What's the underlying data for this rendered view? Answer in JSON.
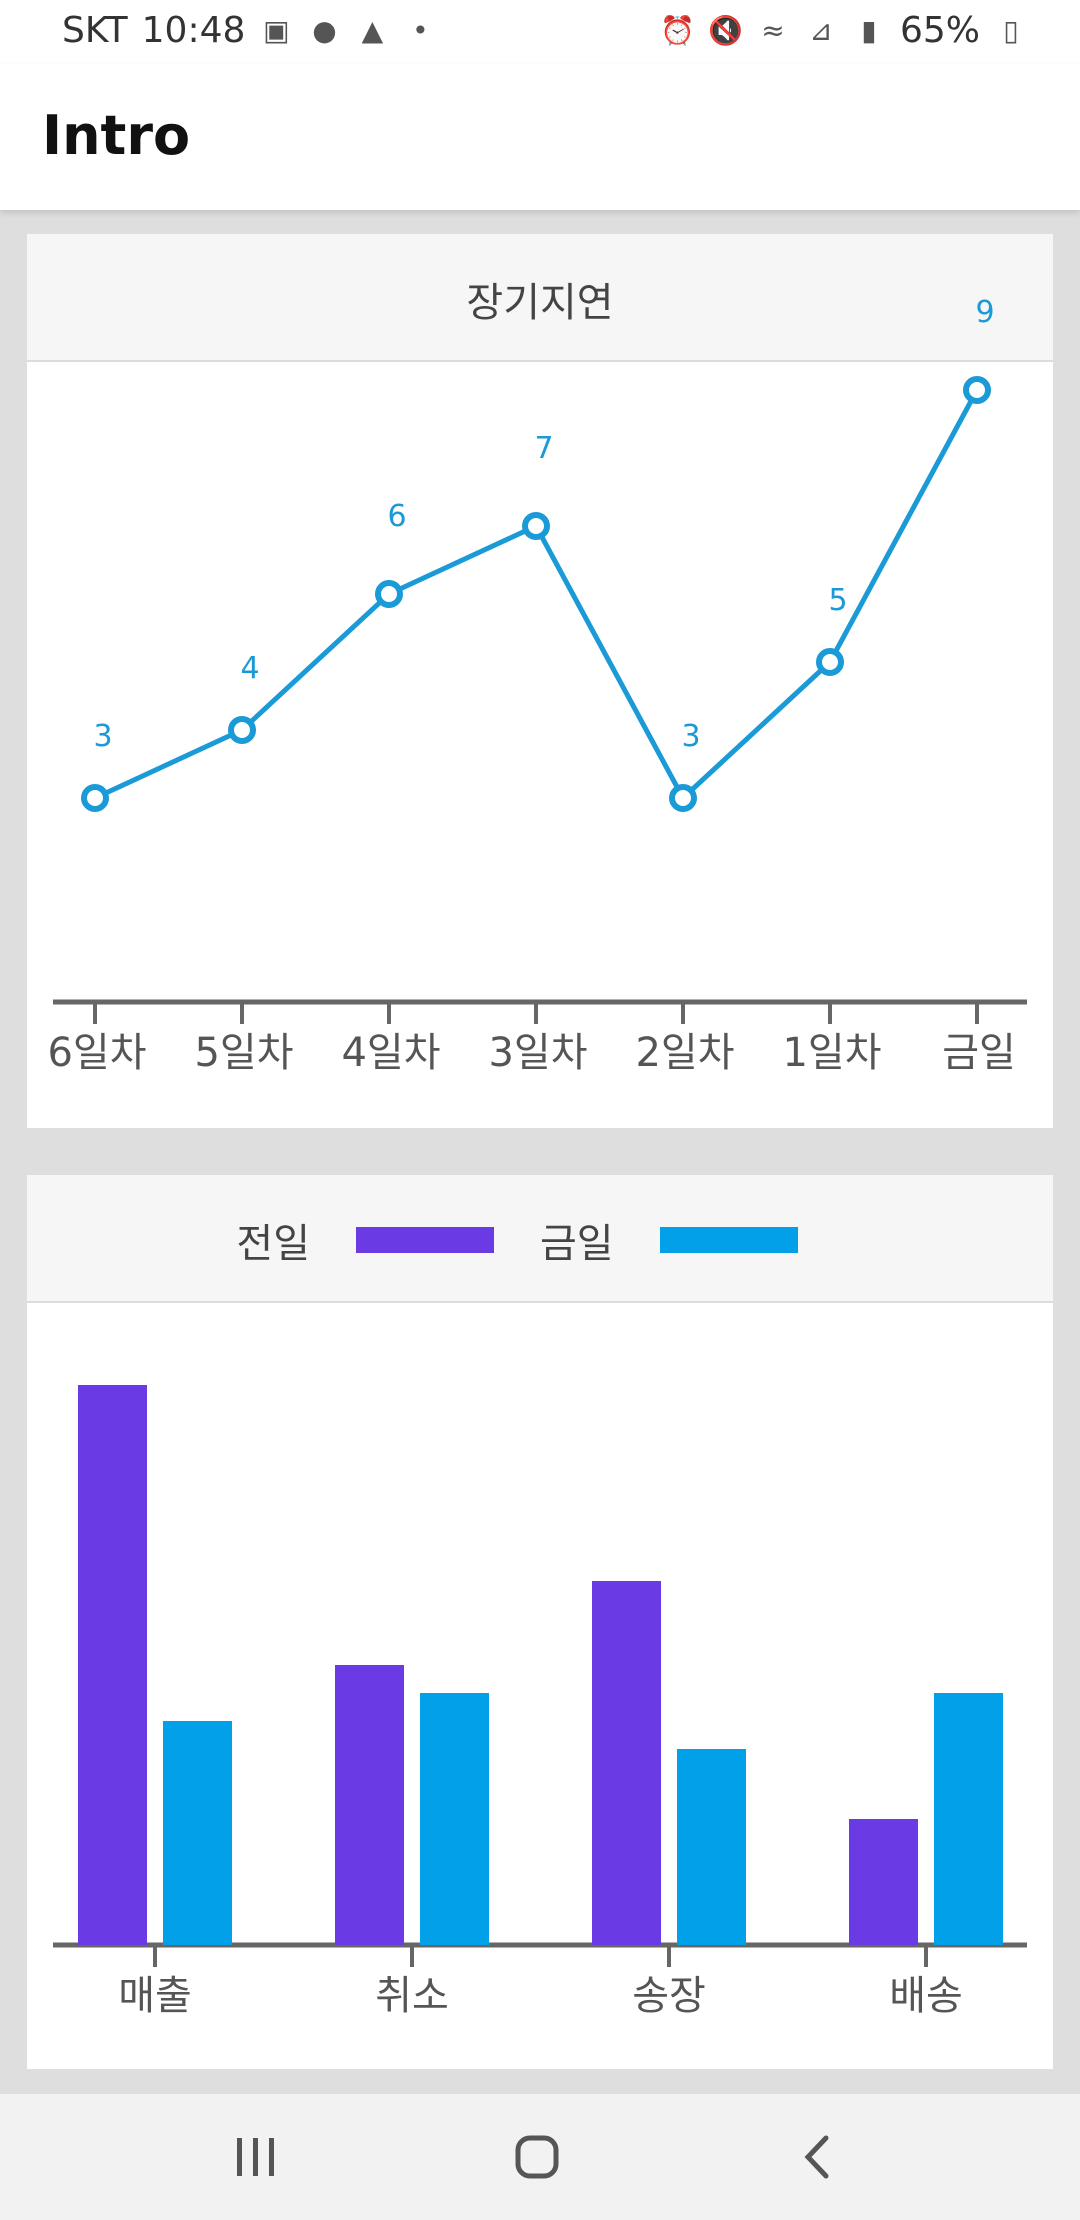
{
  "status_bar": {
    "carrier": "SKT",
    "time": "10:48",
    "left_icons": [
      "image-icon",
      "kakaotalk-icon",
      "app-icon",
      "dot-icon"
    ],
    "right_icons": [
      "alarm-icon",
      "mute-icon",
      "vibrate-icon",
      "wifi-icon",
      "signal-icon"
    ],
    "battery": "65%"
  },
  "app_bar": {
    "title": "Intro"
  },
  "line_card": {
    "title": "장기지연",
    "chart_data": {
      "type": "line",
      "categories": [
        "6일차",
        "5일차",
        "4일차",
        "3일차",
        "2일차",
        "1일차",
        "금일"
      ],
      "values": [
        3,
        4,
        6,
        7,
        3,
        5,
        9
      ],
      "color": "#1a9ad6",
      "data_labels": true
    }
  },
  "bar_card": {
    "legend": [
      {
        "label": "전일",
        "color": "#6a3be4"
      },
      {
        "label": "금일",
        "color": "#03a0ea"
      }
    ],
    "chart_data": {
      "type": "bar",
      "categories": [
        "매출",
        "취소",
        "송장",
        "배송"
      ],
      "series": [
        {
          "name": "전일",
          "values": [
            100,
            50,
            65,
            22.5
          ],
          "color": "#6a3be4"
        },
        {
          "name": "금일",
          "values": [
            40,
            45,
            35,
            45
          ],
          "color": "#03a0ea"
        }
      ],
      "ylim": [
        0,
        105
      ]
    }
  },
  "nav_bar": {
    "recents_icon": "recents-icon",
    "home_icon": "home-icon",
    "back_icon": "back-icon"
  }
}
